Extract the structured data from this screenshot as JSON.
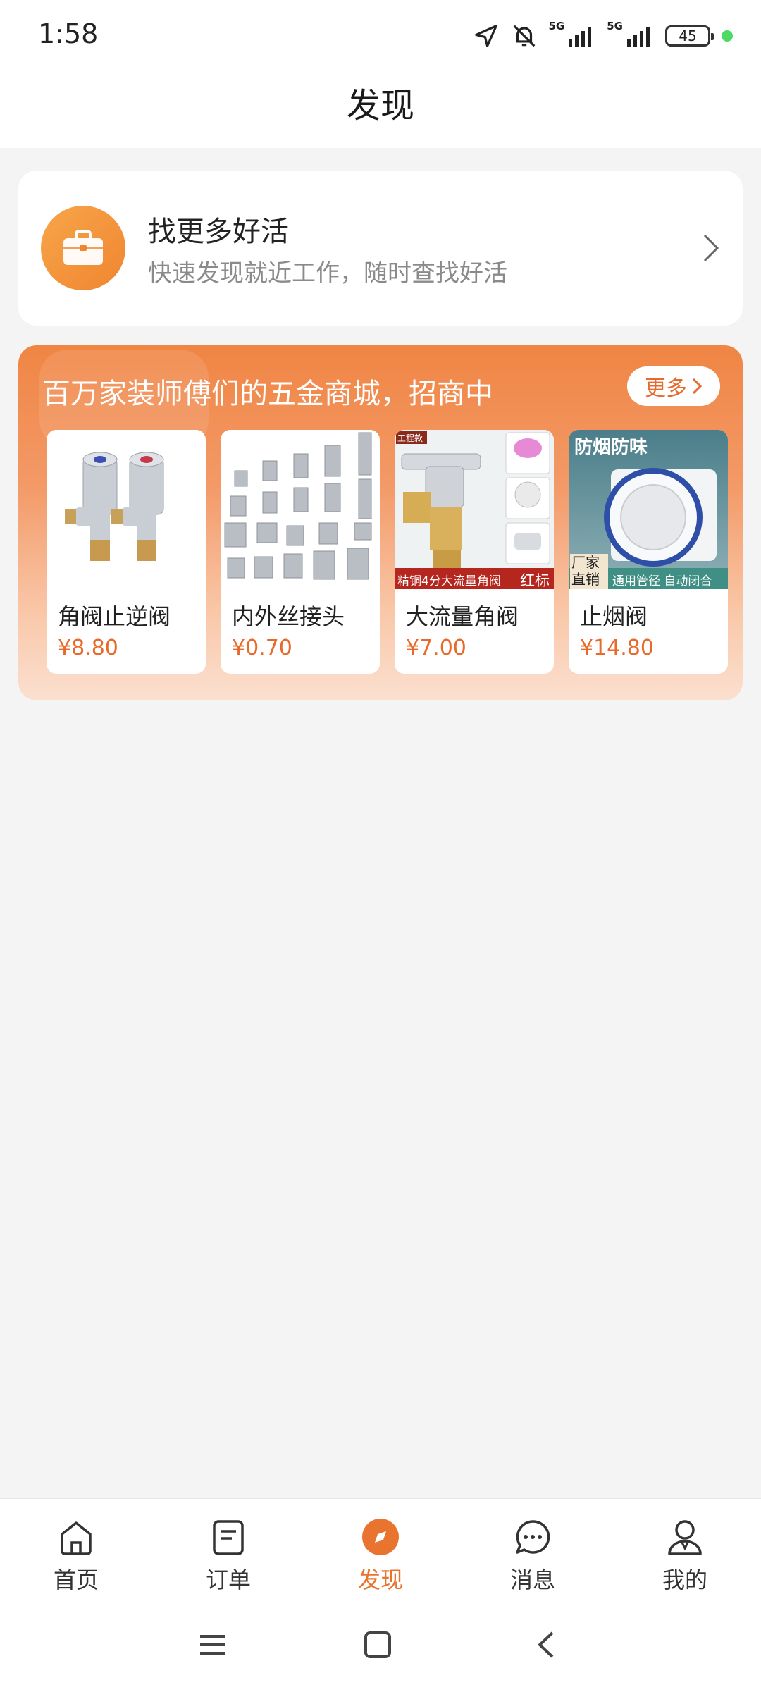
{
  "status_bar": {
    "time": "1:58",
    "battery": "45",
    "network1": "5G",
    "network2": "5G"
  },
  "header": {
    "title": "发现"
  },
  "job_card": {
    "title": "找更多好活",
    "subtitle": "快速发现就近工作，随时查找好活",
    "icon": "briefcase-icon"
  },
  "mall": {
    "title": "百万家装师傅们的五金商城，招商中",
    "more_label": "更多",
    "products": [
      {
        "name": "角阀止逆阀",
        "price": "¥8.80"
      },
      {
        "name": "内外丝接头",
        "price": "¥0.70"
      },
      {
        "name": "大流量角阀",
        "price": "¥7.00",
        "img_tag": "工程款",
        "img_caption": "精铜4分大流量角阀",
        "img_badge": "红标"
      },
      {
        "name": "止烟阀",
        "price": "¥14.80",
        "img_heading": "防烟防味",
        "img_left_tag": "厂家直销",
        "img_caption": "通用管径 自动闭合"
      }
    ]
  },
  "bottom_nav": {
    "items": [
      {
        "label": "首页",
        "icon": "home-icon"
      },
      {
        "label": "订单",
        "icon": "order-icon"
      },
      {
        "label": "发现",
        "icon": "discover-compass-icon",
        "active": true
      },
      {
        "label": "消息",
        "icon": "message-icon"
      },
      {
        "label": "我的",
        "icon": "profile-icon"
      }
    ]
  },
  "colors": {
    "accent": "#e8742f",
    "price": "#e86a2a",
    "background": "#f4f4f4"
  }
}
